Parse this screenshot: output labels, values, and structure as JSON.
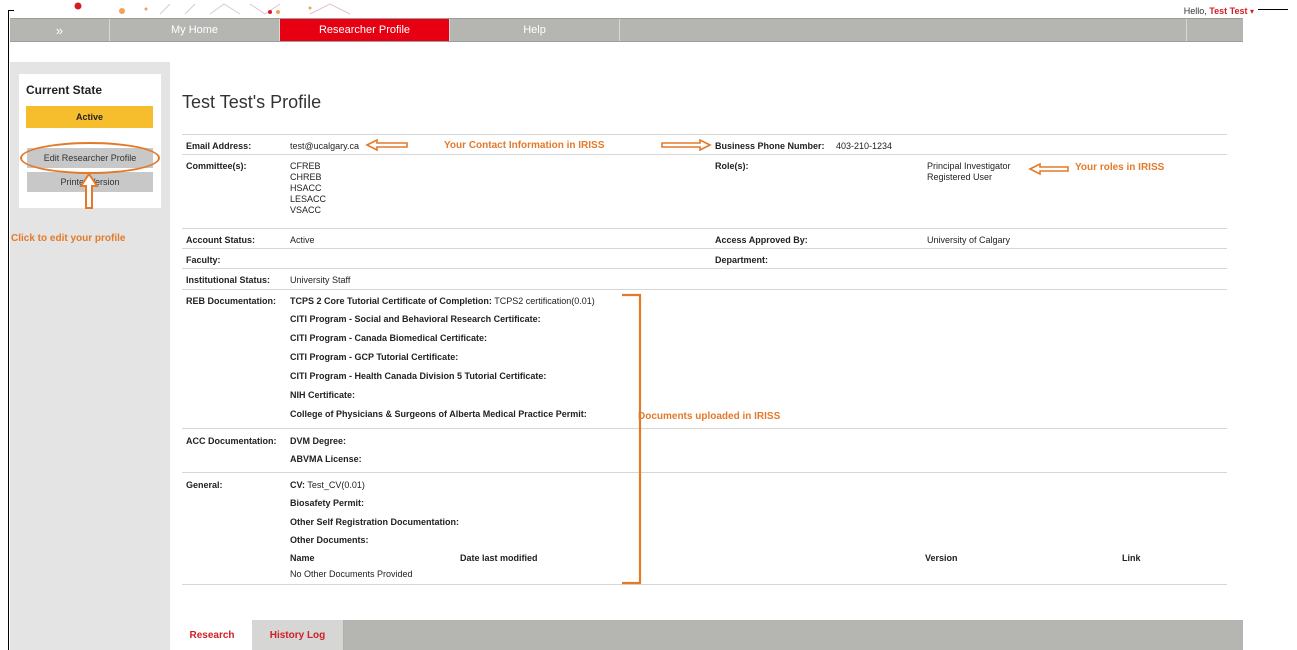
{
  "header": {
    "greeting": "Hello,",
    "user_name": "Test Test",
    "caret": "▾"
  },
  "nav": {
    "expander": "»",
    "items": [
      "My Home",
      "Researcher Profile",
      "Help"
    ],
    "active": "Researcher Profile"
  },
  "sidebar": {
    "current_state_title": "Current State",
    "state_value": "Active",
    "edit_button": "Edit Researcher Profile",
    "print_button": "Printer Version"
  },
  "profile": {
    "title": "Test Test's Profile",
    "email_label": "Email Address:",
    "email_value": "test@ucalgary.ca",
    "phone_label": "Business Phone Number:",
    "phone_value": "403-210-1234",
    "committees_label": "Committee(s):",
    "committees": [
      "CFREB",
      "CHREB",
      "HSACC",
      "LESACC",
      "VSACC"
    ],
    "roles_label": "Role(s):",
    "roles": [
      "Principal Investigator",
      "Registered User"
    ],
    "account_status_label": "Account Status:",
    "account_status_value": "Active",
    "access_approved_label": "Access Approved By:",
    "access_approved_value": "University of Calgary",
    "faculty_label": "Faculty:",
    "department_label": "Department:",
    "institutional_status_label": "Institutional Status:",
    "institutional_status_value": "University Staff",
    "reb_label": "REB Documentation:",
    "reb_docs": [
      {
        "name": "TCPS 2 Core Tutorial Certificate of Completion:",
        "value": "TCPS2 certification(0.01)"
      },
      {
        "name": "CITI Program - Social and Behavioral Research Certificate:",
        "value": ""
      },
      {
        "name": "CITI Program - Canada Biomedical Certificate:",
        "value": ""
      },
      {
        "name": "CITI Program - GCP Tutorial Certificate:",
        "value": ""
      },
      {
        "name": "CITI Program - Health Canada Division 5 Tutorial Certificate:",
        "value": ""
      },
      {
        "name": "NIH Certificate:",
        "value": ""
      },
      {
        "name": "College of Physicians & Surgeons of Alberta Medical Practice Permit:",
        "value": ""
      }
    ],
    "acc_label": "ACC Documentation:",
    "acc_docs": [
      {
        "name": "DVM Degree:",
        "value": ""
      },
      {
        "name": "ABVMA License:",
        "value": ""
      }
    ],
    "general_label": "General:",
    "general_docs": [
      {
        "name": "CV:",
        "value": "Test_CV(0.01)"
      },
      {
        "name": "Biosafety Permit:",
        "value": ""
      },
      {
        "name": "Other Self Registration Documentation:",
        "value": ""
      },
      {
        "name": "Other Documents:",
        "value": ""
      }
    ],
    "other_docs_columns": [
      "Name",
      "Date last modified",
      "Version",
      "Link"
    ],
    "other_docs_empty": "No Other Documents Provided"
  },
  "annotations": {
    "contact": "Your Contact Information in IRISS",
    "roles": "Your roles in IRISS",
    "documents": "Documents uploaded in IRISS",
    "edit": "Click to edit your profile"
  },
  "tabs": [
    "Research",
    "History Log"
  ],
  "colors": {
    "accent_red": "#e60012",
    "annotation_orange": "#e37a2a",
    "state_yellow": "#f6be2d",
    "nav_gray": "#b5b5b2"
  }
}
